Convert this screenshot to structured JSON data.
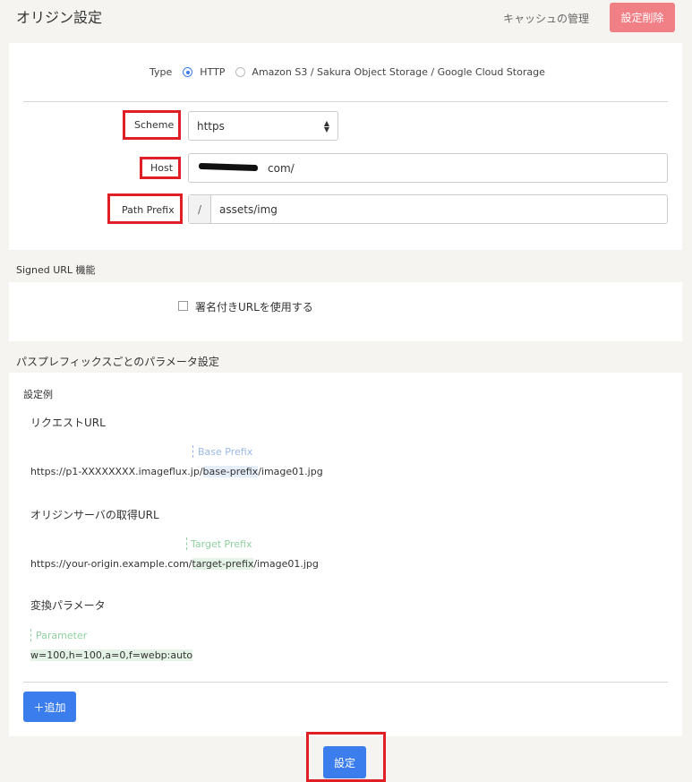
{
  "header": {
    "title": "オリジン設定",
    "cache_link": "キャッシュの管理",
    "delete_button": "設定削除"
  },
  "origin": {
    "type_label": "Type",
    "type_options": [
      "HTTP",
      "Amazon S3 / Sakura Object Storage / Google Cloud Storage"
    ],
    "type_selected": "HTTP",
    "scheme_label": "Scheme",
    "scheme_value": "https",
    "host_label": "Host",
    "host_value_visible": "com/",
    "path_prefix_label": "Path Prefix",
    "path_prefix_slash": "/",
    "path_prefix_value": "assets/img"
  },
  "signed_url": {
    "section_title": "Signed URL 機能",
    "checkbox_label": "署名付きURLを使用する",
    "checked": false
  },
  "params": {
    "section_title": "パスプレフィックスごとのパラメータ設定",
    "example_title": "設定例",
    "request_url_title": "リクエストURL",
    "base_prefix_label": "Base Prefix",
    "request_url_before": "https://p1-XXXXXXXX.imageflux.jp/",
    "request_url_prefix": "base-prefix",
    "request_url_after": "/image01.jpg",
    "origin_url_title": "オリジンサーバの取得URL",
    "target_prefix_label": "Target Prefix",
    "origin_url_before": "https://your-origin.example.com/",
    "origin_url_prefix": "target-prefix",
    "origin_url_after": "/image01.jpg",
    "transform_title": "変換パラメータ",
    "parameter_label": "Parameter",
    "parameter_value": "w=100,h=100,a=0,f=webp:auto",
    "add_button": "＋追加"
  },
  "footer": {
    "submit_button": "設定"
  },
  "colors": {
    "primary": "#3b7ded",
    "danger": "#f07f86",
    "highlight_box": "#e01e26"
  }
}
